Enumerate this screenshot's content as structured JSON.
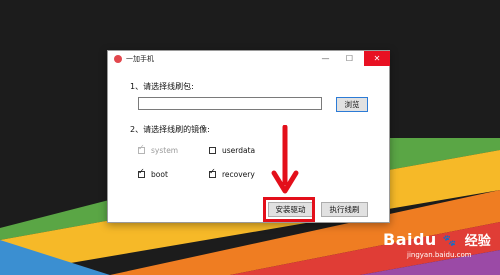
{
  "window": {
    "title": "一加手机",
    "controls": {
      "minimize": "—",
      "maximize": "☐",
      "close": "✕"
    }
  },
  "section1": {
    "label": "1、请选择线刷包:",
    "path_value": "",
    "browse_label": "浏览"
  },
  "section2": {
    "label": "2、请选择线刷的镜像:",
    "images": [
      {
        "label": "system",
        "checked": true,
        "enabled": false
      },
      {
        "label": "userdata",
        "checked": false,
        "enabled": true
      },
      {
        "label": "boot",
        "checked": true,
        "enabled": true
      },
      {
        "label": "recovery",
        "checked": true,
        "enabled": true
      }
    ]
  },
  "actions": {
    "install_driver_label": "安装驱动",
    "flash_label": "执行线刷"
  },
  "annotation": {
    "color": "#e30f1a"
  },
  "watermark": {
    "brand": "Baidu",
    "cn": "经验",
    "url": "jingyan.baidu.com"
  }
}
